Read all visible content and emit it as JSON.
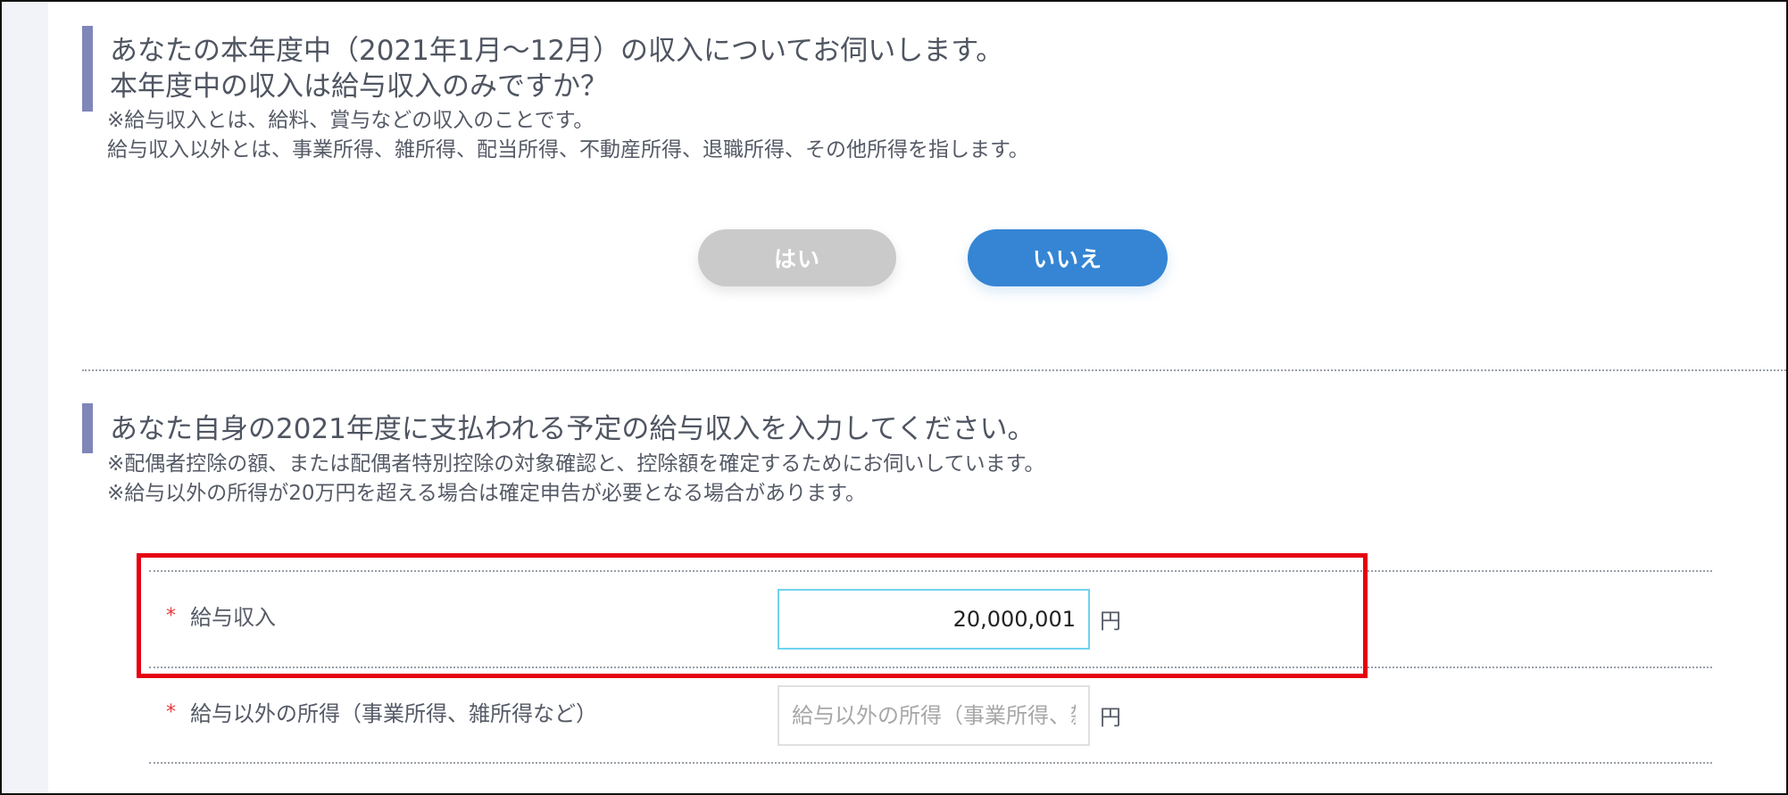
{
  "section1": {
    "title_line1": "あなたの本年度中（2021年1月～12月）の収入についてお伺いします。",
    "title_line2": "本年度中の収入は給与収入のみですか？",
    "note_line1": "※給与収入とは、給料、賞与などの収入のことです。",
    "note_line2": "給与収入以外とは、事業所得、雑所得、配当所得、不動産所得、退職所得、その他所得を指します。",
    "yes_label": "はい",
    "no_label": "いいえ"
  },
  "section2": {
    "title": "あなた自身の2021年度に支払われる予定の給与収入を入力してください。",
    "note_line1": "※配偶者控除の額、または配偶者特別控除の対象確認と、控除額を確定するためにお伺いしています。",
    "note_line2": "※給与以外の所得が20万円を超える場合は確定申告が必要となる場合があります。",
    "fields": [
      {
        "required_mark": "*",
        "label": "給与収入",
        "value": "20,000,001",
        "placeholder": "",
        "unit": "円"
      },
      {
        "required_mark": "*",
        "label": "給与以外の所得（事業所得、雑所得など）",
        "value": "",
        "placeholder": "給与以外の所得（事業所得、雑所得など）",
        "unit": "円"
      }
    ]
  },
  "colors": {
    "accent_bar": "#7f86b8",
    "yes_button": "#cacaca",
    "no_button": "#3585d4",
    "required": "#e63a3a",
    "highlight": "#e60012",
    "active_input_border": "#6fd3ee"
  }
}
